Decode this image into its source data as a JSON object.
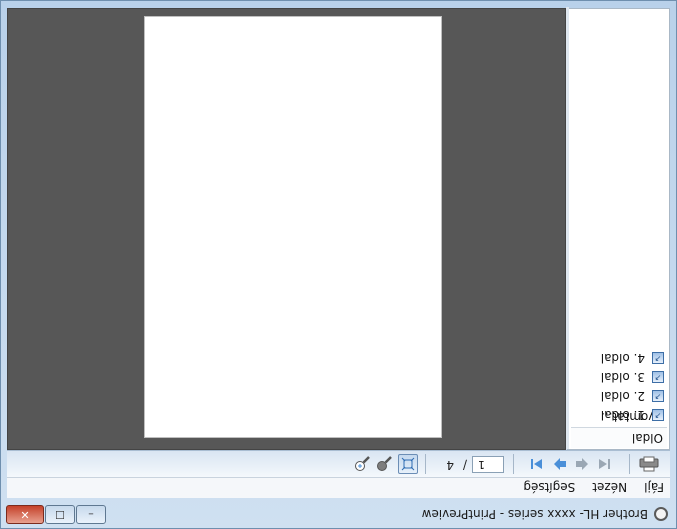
{
  "window": {
    "title": "Brother HL- xxxx  series - PrintPreview",
    "buttons": {
      "minimize": "–",
      "maximize": "☐",
      "close": "✕"
    }
  },
  "menu": {
    "items": [
      "Fájl",
      "Nézet",
      "Segítség"
    ]
  },
  "toolbar": {
    "print_icon": "printer-icon",
    "first_icon": "first-page-icon",
    "prev_icon": "previous-page-icon",
    "next_icon": "next-page-icon",
    "last_icon": "last-page-icon",
    "current_page": "1",
    "page_separator": "/",
    "total_pages": "4",
    "fit_icon": "fit-page-icon",
    "zoom_out_icon": "zoom-out-icon",
    "zoom_in_icon": "zoom-in-icon"
  },
  "side_panel": {
    "page_setup_label": "Oldal nyomtat...",
    "pages": [
      "1. oldal",
      "2. oldal",
      "3. oldal",
      "4. oldal"
    ]
  },
  "colors": {
    "preview_background": "#575757",
    "paper": "#ffffff",
    "toolbar_accent": "#4a7fc1"
  }
}
